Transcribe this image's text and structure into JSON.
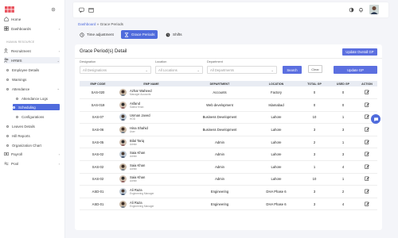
{
  "sidebar": {
    "top_items": [
      {
        "label": "Home",
        "icon": "home-icon"
      },
      {
        "label": "Dashboards",
        "icon": "dashboard-icon"
      }
    ],
    "section_label": "HUMAN RESOURCE",
    "groups": [
      {
        "label": "Recruitment",
        "icon": "person-add-icon"
      },
      {
        "label": "HRMS",
        "icon": "people-icon"
      }
    ],
    "hrms_items": [
      "Employee Details",
      "Warnings",
      "Attendance"
    ],
    "attendance_items": [
      "Attendance Logs",
      "Scheduling",
      "Configurations"
    ],
    "more_hrms_items": [
      "Leaves Details",
      "Hill Reports",
      "Organization Chart"
    ],
    "bottom_groups": [
      {
        "label": "Payroll",
        "icon": "payroll-icon"
      },
      {
        "label": "Pool",
        "icon": "pool-icon"
      }
    ]
  },
  "breadcrumb": {
    "root": "Dashboard",
    "sep": "»",
    "current": "Grace Periods"
  },
  "tabs": [
    {
      "label": "Time adjustment",
      "icon": "clock-icon"
    },
    {
      "label": "Grace Periods",
      "icon": "hourglass-icon"
    },
    {
      "label": "Shifts",
      "icon": "shifts-icon"
    }
  ],
  "card": {
    "title": "Grace Period(s) Detail",
    "update_overall_label": "Update Overall GP",
    "update_gp_label": "Update GP",
    "filters": {
      "designation_label": "Designation",
      "designation_value": "All Designations",
      "location_label": "Location",
      "location_value": "All Locations",
      "department_label": "Department",
      "department_value": "All Departments"
    },
    "search_label": "Search",
    "clear_label": "Clear"
  },
  "table": {
    "headers": [
      "EMP CODE",
      "EMP NAME",
      "DEPARTMENT",
      "LOCATION",
      "TOTAL GP",
      "USED GP",
      "ACTION"
    ],
    "rows": [
      {
        "code": "SAS-020",
        "name": "Azhar Waheed",
        "role": "Manager Accounts",
        "dept": "Accounts",
        "loc": "Factory",
        "total": "0",
        "used": "0"
      },
      {
        "code": "SAS-019",
        "name": "Asfand",
        "role": "Sasha Khan",
        "dept": "Web development",
        "loc": "Islamabad",
        "total": "0",
        "used": "0"
      },
      {
        "code": "SAS-07",
        "name": "Usman Javed",
        "role": "HOD",
        "dept": "Business Development",
        "loc": "Lahore",
        "total": "10",
        "used": "1"
      },
      {
        "code": "SAS-06",
        "name": "Hina Shahid",
        "role": "User",
        "dept": "Business Development",
        "loc": "Lahore",
        "total": "3",
        "used": "3"
      },
      {
        "code": "SAS-05",
        "name": "Bilal Tariq",
        "role": "Admin",
        "dept": "Admin",
        "loc": "Lahore",
        "total": "2",
        "used": "1"
      },
      {
        "code": "SAS-02",
        "name": "Saia Khan",
        "role": "Admin",
        "dept": "Admin",
        "loc": "Lahore",
        "total": "3",
        "used": "3"
      },
      {
        "code": "SAS-02",
        "name": "Saia Khan",
        "role": "Admin",
        "dept": "Admin",
        "loc": "Lahore",
        "total": "1",
        "used": "4"
      },
      {
        "code": "SAS-02",
        "name": "Saia Khan",
        "role": "Admin",
        "dept": "Admin",
        "loc": "Lahore",
        "total": "10",
        "used": "1"
      },
      {
        "code": "ASD-01",
        "name": "Ali Raza",
        "role": "Engineering Manager",
        "dept": "Engineering",
        "loc": "DHA Phase 6",
        "total": "3",
        "used": "2"
      },
      {
        "code": "ASD-01",
        "name": "Ali Raza",
        "role": "Engineering Manager",
        "dept": "Engineering",
        "loc": "DHA Phase 6",
        "total": "3",
        "used": "4"
      }
    ]
  },
  "colors": {
    "accent": "#4f6bdc",
    "logo": "#e8505b"
  }
}
